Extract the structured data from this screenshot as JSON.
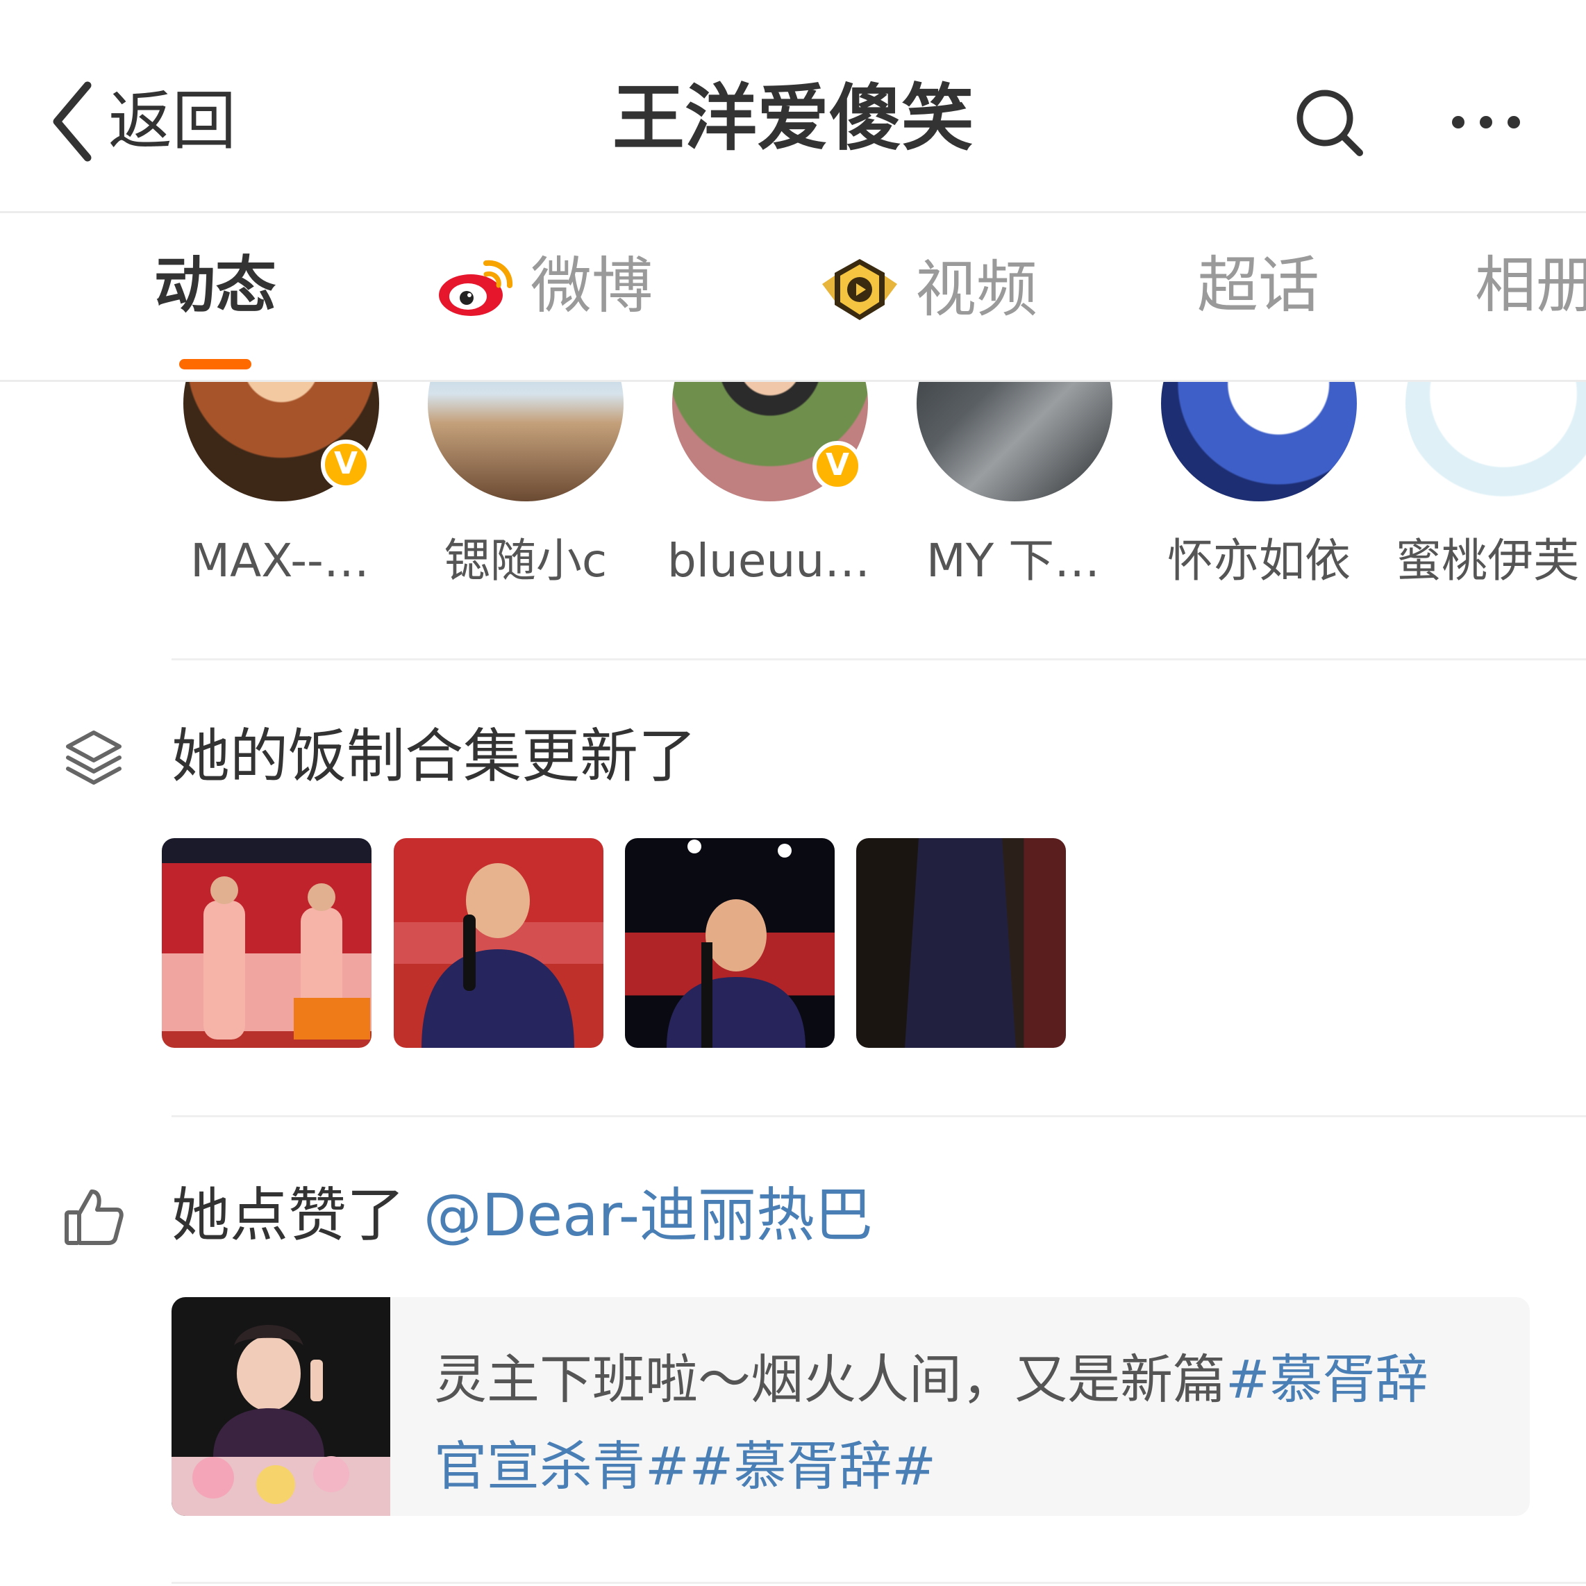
{
  "header": {
    "back_label": "返回",
    "title": "王洋爱傻笑"
  },
  "tabs": [
    {
      "label": "动态",
      "icon": "none",
      "active": true
    },
    {
      "label": "微博",
      "icon": "weibo-logo-icon",
      "active": false
    },
    {
      "label": "视频",
      "icon": "video-badge-icon",
      "active": false
    },
    {
      "label": "超话",
      "icon": "none",
      "active": false
    },
    {
      "label": "相册",
      "icon": "none",
      "active": false
    }
  ],
  "follows": [
    {
      "name": "MAX--…",
      "verified": true,
      "verified_mark": "V"
    },
    {
      "name": "锶随小c",
      "verified": false
    },
    {
      "name": "blueuu…",
      "verified": true,
      "verified_mark": "V"
    },
    {
      "name": "MY 下…",
      "verified": false
    },
    {
      "name": "怀亦如依",
      "verified": false
    },
    {
      "name": "蜜桃伊芙",
      "verified": false
    }
  ],
  "collection": {
    "icon": "layers-icon",
    "text": "她的饭制合集更新了",
    "thumbnail_count": 4
  },
  "liked": {
    "icon": "thumbs-up-icon",
    "prefix": "她点赞了",
    "mention": "@Dear-迪丽热巴",
    "post": {
      "text_plain": "灵主下班啦～烟火人间，又是新篇",
      "tag_1": "#慕胥辞",
      "tag_2": "官宣杀青##慕胥辞#"
    }
  },
  "colors": {
    "accent_orange": "#ff6a00",
    "link_blue": "#4a7fb5",
    "verified_yellow": "#ffb400"
  }
}
